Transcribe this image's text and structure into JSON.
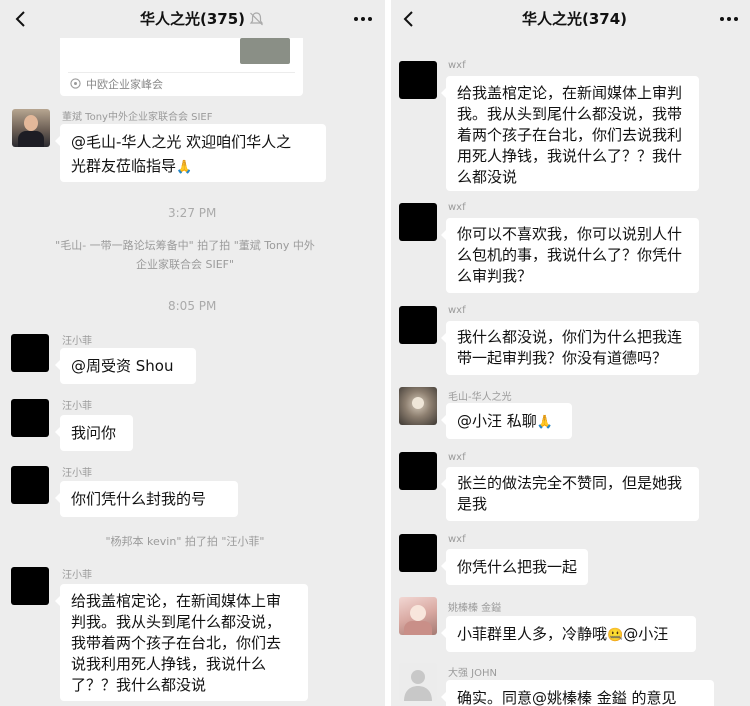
{
  "left": {
    "header": {
      "title": "华人之光(375)"
    },
    "card_source": "中欧企业家峰会",
    "messages": [
      {
        "sender": "董斌 Tony中外企业家联合会 SIEF",
        "lines": [
          "@毛山-华人之光 欢迎咱们华人之",
          "光群友莅临指导"
        ],
        "emoji": "🙏"
      },
      {
        "sender": "汪小菲",
        "lines": [
          "@周受资 Shou"
        ]
      },
      {
        "sender": "汪小菲",
        "lines": [
          "我问你"
        ]
      },
      {
        "sender": "汪小菲",
        "lines": [
          "你们凭什么封我的号"
        ]
      },
      {
        "sender": "汪小菲",
        "lines": [
          "给我盖棺定论，在新闻媒体上审",
          "判我。我从头到尾什么都没说，",
          "我带着两个孩子在台北，你们去",
          "说我利用死人挣钱，我说什么",
          "了？？我什么都没说"
        ]
      }
    ],
    "times": [
      "3:27 PM",
      "8:05 PM"
    ],
    "system": [
      [
        "\"毛山- 一带一路论坛筹备中\" 拍了拍 \"董斌 Tony 中外",
        "企业家联合会 SIEF\""
      ],
      [
        "\"杨邦本 kevin\" 拍了拍 \"汪小菲\""
      ]
    ]
  },
  "right": {
    "header": {
      "title": "华人之光(374)"
    },
    "messages": [
      {
        "sender": "wxf",
        "lines": [
          "给我盖棺定论，在新闻媒体上审判",
          "我。我从头到尾什么都没说，我带",
          "着两个孩子在台北，你们去说我利",
          "用死人挣钱，我说什么了？？我什",
          "么都没说"
        ]
      },
      {
        "sender": "wxf",
        "lines": [
          "你可以不喜欢我，你可以说别人什",
          "么包机的事，我说什么了？你凭什",
          "么审判我？"
        ]
      },
      {
        "sender": "wxf",
        "lines": [
          "我什么都没说，你们为什么把我连",
          "带一起审判我？你没有道德吗？"
        ]
      },
      {
        "sender": "毛山-华人之光",
        "lines": [
          "@小汪  私聊"
        ],
        "emoji": "🙏"
      },
      {
        "sender": "wxf",
        "lines": [
          "张兰的做法完全不赞同，但是她我",
          "是我"
        ]
      },
      {
        "sender": "wxf",
        "lines": [
          "你凭什么把我一起"
        ]
      },
      {
        "sender": "姚榛榛 金鎰",
        "lines": [
          "小菲群里人多，冷静哦",
          "@小汪"
        ],
        "emoji": "🤐"
      },
      {
        "sender": "大强 JOHN",
        "lines": [
          "确实。同意@姚榛榛 金鎰  的意见"
        ]
      }
    ]
  }
}
